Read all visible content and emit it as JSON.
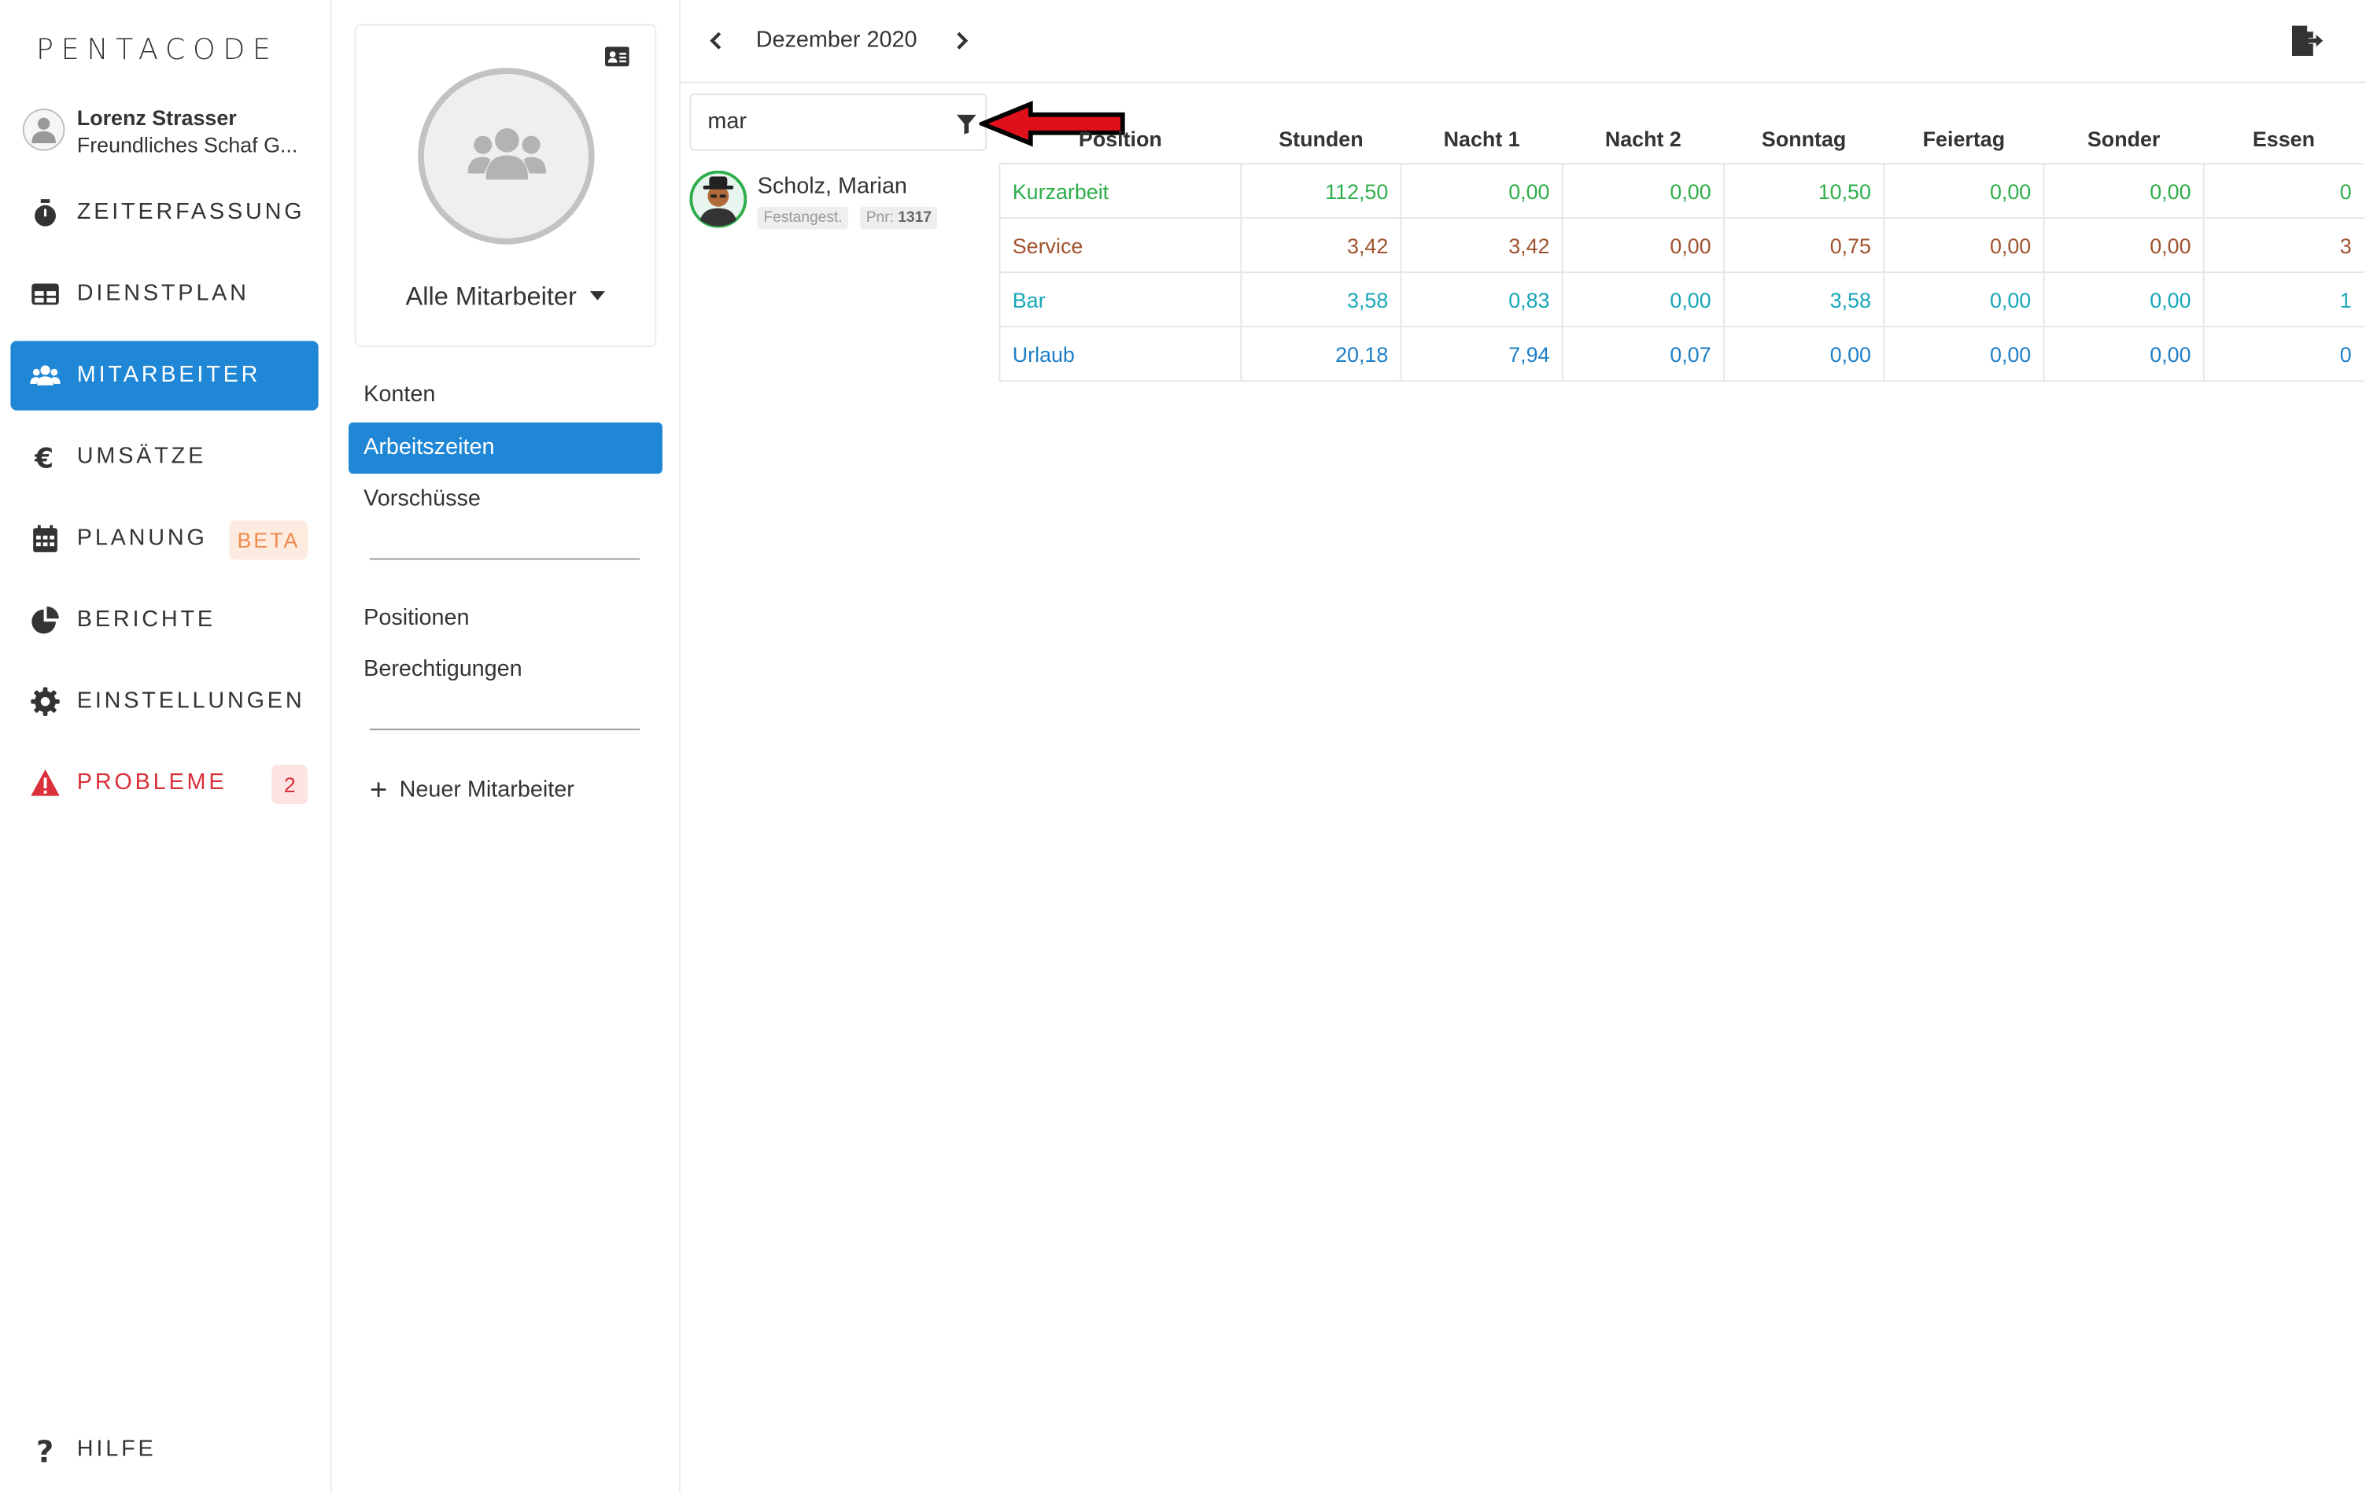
{
  "app": {
    "logo": "PENTACODE"
  },
  "user": {
    "name": "Lorenz Strasser",
    "org": "Freundliches Schaf G..."
  },
  "nav": {
    "items": [
      {
        "label": "ZEITERFASSUNG",
        "icon": "stopwatch-icon"
      },
      {
        "label": "DIENSTPLAN",
        "icon": "table-icon"
      },
      {
        "label": "MITARBEITER",
        "icon": "users-icon",
        "active": true
      },
      {
        "label": "UMSÄTZE",
        "icon": "euro-icon"
      },
      {
        "label": "PLANUNG",
        "icon": "calendar-icon",
        "badge": "BETA"
      },
      {
        "label": "BERICHTE",
        "icon": "pie-chart-icon"
      },
      {
        "label": "EINSTELLUNGEN",
        "icon": "gear-icon"
      },
      {
        "label": "PROBLEME",
        "icon": "warning-icon",
        "badge": "2"
      }
    ],
    "help": "HILFE"
  },
  "employees_panel": {
    "group_select": "Alle Mitarbeiter",
    "menu": [
      "Konten",
      "Arbeitszeiten",
      "Vorschüsse"
    ],
    "menu2": [
      "Positionen",
      "Berechtigungen"
    ],
    "new_employee": "Neuer Mitarbeiter"
  },
  "main": {
    "month": "Dezember 2020",
    "search_value": "mar",
    "employee": {
      "name": "Scholz, Marian",
      "type": "Festangest.",
      "pnr_label": "Pnr:",
      "pnr": "1317"
    },
    "table": {
      "headers": [
        "Position",
        "Stunden",
        "Nacht 1",
        "Nacht 2",
        "Sonntag",
        "Feiertag",
        "Sonder",
        "Essen"
      ],
      "rows": [
        {
          "color": "#2eae4a",
          "cells": [
            "Kurzarbeit",
            "112,50",
            "0,00",
            "0,00",
            "10,50",
            "0,00",
            "0,00",
            "0"
          ]
        },
        {
          "color": "#a0522d",
          "cells": [
            "Service",
            "3,42",
            "3,42",
            "0,00",
            "0,75",
            "0,00",
            "0,00",
            "3"
          ]
        },
        {
          "color": "#17a6b8",
          "cells": [
            "Bar",
            "3,58",
            "0,83",
            "0,00",
            "3,58",
            "0,00",
            "0,00",
            "1"
          ]
        },
        {
          "color": "#1f7fc6",
          "cells": [
            "Urlaub",
            "20,18",
            "7,94",
            "0,07",
            "0,00",
            "0,00",
            "0,00",
            "0"
          ]
        }
      ]
    }
  },
  "colors": {
    "accent": "#1f87d6",
    "danger": "#d9303a",
    "beta": "#f08a4b"
  }
}
